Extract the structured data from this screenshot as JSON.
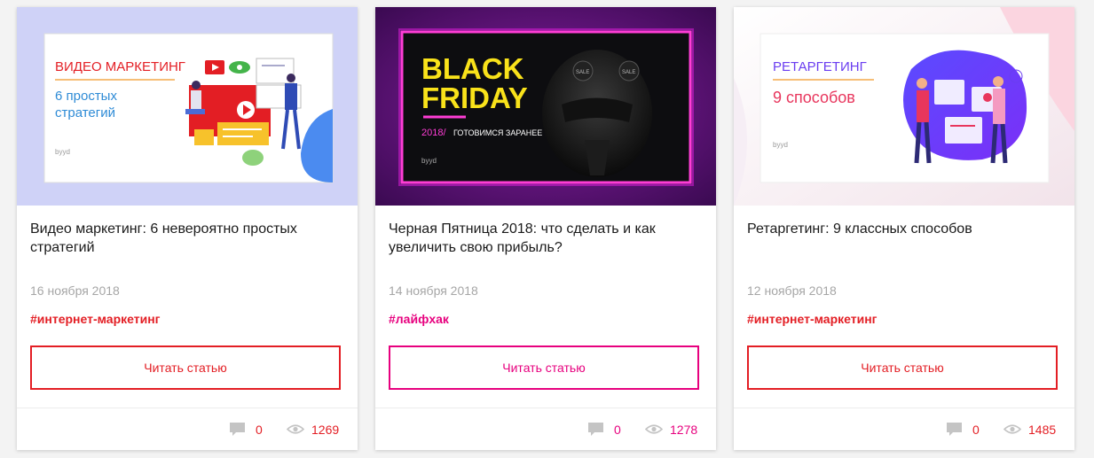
{
  "colors": {
    "red": "#e31e24",
    "pink": "#e7007e",
    "date": "#a6a6a6",
    "icon": "#c4c4c4"
  },
  "cards": [
    {
      "image": {
        "heading": "ВИДЕО МАРКЕТИНГ",
        "subheading_line1": "6 простых",
        "subheading_line2": "стратегий",
        "brand": "byyd"
      },
      "title": "Видео маркетинг: 6 невероятно простых стратегий",
      "date": "16 ноября 2018",
      "tag": "#интернет-маркетинг",
      "button": "Читать статью",
      "comments": "0",
      "views": "1269",
      "accent": "red"
    },
    {
      "image": {
        "heading_line1": "BLACK",
        "heading_line2": "FRIDAY",
        "year": "2018/",
        "caption": "ГОТОВИМСЯ ЗАРАНЕЕ",
        "badge": "SALE",
        "brand": "byyd"
      },
      "title": "Черная Пятница 2018: что сделать и как увеличить свою прибыль?",
      "date": "14 ноября 2018",
      "tag": "#лайфхак",
      "button": "Читать статью",
      "comments": "0",
      "views": "1278",
      "accent": "pink"
    },
    {
      "image": {
        "heading": "РЕТАРГЕТИНГ",
        "subheading": "9 способов",
        "brand": "byyd"
      },
      "title": "Ретаргетинг: 9 классных способов",
      "date": "12 ноября 2018",
      "tag": "#интернет-маркетинг",
      "button": "Читать статью",
      "comments": "0",
      "views": "1485",
      "accent": "red"
    }
  ]
}
